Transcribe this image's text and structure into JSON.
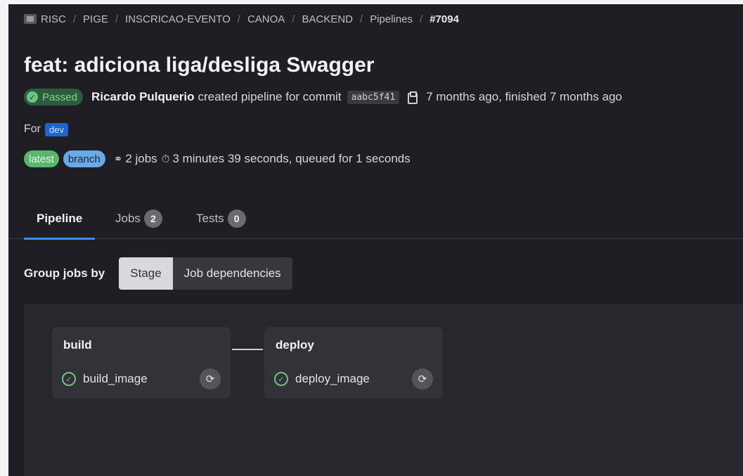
{
  "breadcrumb": {
    "items": [
      "RISC",
      "PIGE",
      "INSCRICAO-EVENTO",
      "CANOA",
      "BACKEND",
      "Pipelines"
    ],
    "current": "#7094",
    "separator": "/"
  },
  "pipeline": {
    "title": "feat: adiciona liga/desliga Swagger",
    "status": "Passed",
    "author": "Ricardo Pulquerio",
    "action_text": "created pipeline for commit",
    "commit_sha": "aabc5f41",
    "time_text": "7 months ago, finished 7 months ago",
    "for_label": "For",
    "ref": "dev",
    "badges": [
      "latest",
      "branch"
    ],
    "jobs_text": "2 jobs",
    "duration_text": "3 minutes 39 seconds, queued for 1 seconds"
  },
  "tabs": [
    {
      "label": "Pipeline",
      "count": null
    },
    {
      "label": "Jobs",
      "count": "2"
    },
    {
      "label": "Tests",
      "count": "0"
    }
  ],
  "group": {
    "label": "Group jobs by",
    "options": [
      "Stage",
      "Job dependencies"
    ],
    "selected": "Stage"
  },
  "stages": [
    {
      "name": "build",
      "job": "build_image",
      "status": "success"
    },
    {
      "name": "deploy",
      "job": "deploy_image",
      "status": "success"
    }
  ],
  "colors": {
    "background": "#1f1e24",
    "success": "#6cc485",
    "accent": "#3d8bfd",
    "ref": "#1d66d1"
  }
}
